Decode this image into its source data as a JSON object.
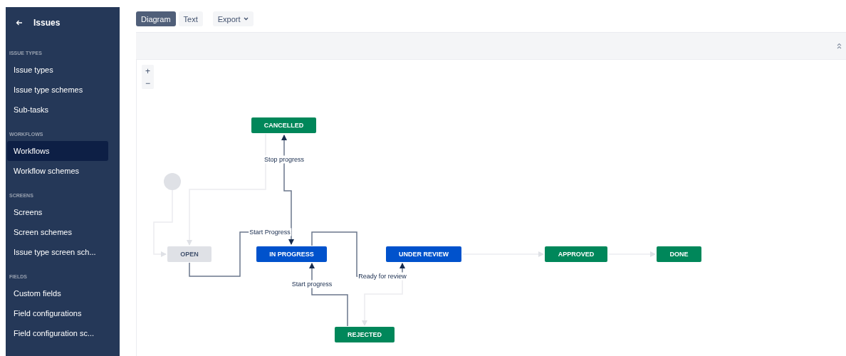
{
  "sidebar": {
    "back_label": "Issues",
    "sections": [
      {
        "heading": "ISSUE TYPES",
        "items": [
          {
            "label": "Issue types",
            "selected": false
          },
          {
            "label": "Issue type schemes",
            "selected": false
          },
          {
            "label": "Sub-tasks",
            "selected": false
          }
        ]
      },
      {
        "heading": "WORKFLOWS",
        "items": [
          {
            "label": "Workflows",
            "selected": true
          },
          {
            "label": "Workflow schemes",
            "selected": false
          }
        ]
      },
      {
        "heading": "SCREENS",
        "items": [
          {
            "label": "Screens",
            "selected": false
          },
          {
            "label": "Screen schemes",
            "selected": false
          },
          {
            "label": "Issue type screen sch...",
            "selected": false
          }
        ]
      },
      {
        "heading": "FIELDS",
        "items": [
          {
            "label": "Custom fields",
            "selected": false
          },
          {
            "label": "Field configurations",
            "selected": false
          },
          {
            "label": "Field configuration sc...",
            "selected": false
          }
        ]
      }
    ]
  },
  "toolbar": {
    "view_tabs": [
      {
        "label": "Diagram",
        "selected": true
      },
      {
        "label": "Text",
        "selected": false
      }
    ],
    "export_button": "Export"
  },
  "diagram": {
    "zoom_in": "+",
    "zoom_out": "−",
    "statuses": [
      {
        "label": "CANCELLED",
        "color": "#00875a"
      },
      {
        "label": "OPEN",
        "color": "#dfe1e6"
      },
      {
        "label": "IN PROGRESS",
        "color": "#0052cc"
      },
      {
        "label": "UNDER REVIEW",
        "color": "#0052cc"
      },
      {
        "label": "APPROVED",
        "color": "#00875a"
      },
      {
        "label": "DONE",
        "color": "#00875a"
      },
      {
        "label": "REJECTED",
        "color": "#00875a"
      }
    ],
    "transitions": [
      {
        "highlighted": false
      },
      {
        "highlighted": false
      },
      {
        "label": "Start Progress",
        "highlighted": true
      },
      {
        "label": "Stop progress",
        "highlighted": true
      },
      {
        "label": "Ready for review",
        "highlighted": true
      },
      {
        "label": "Start progress",
        "highlighted": true
      },
      {
        "highlighted": false
      },
      {
        "highlighted": false
      },
      {
        "highlighted": false
      }
    ]
  }
}
